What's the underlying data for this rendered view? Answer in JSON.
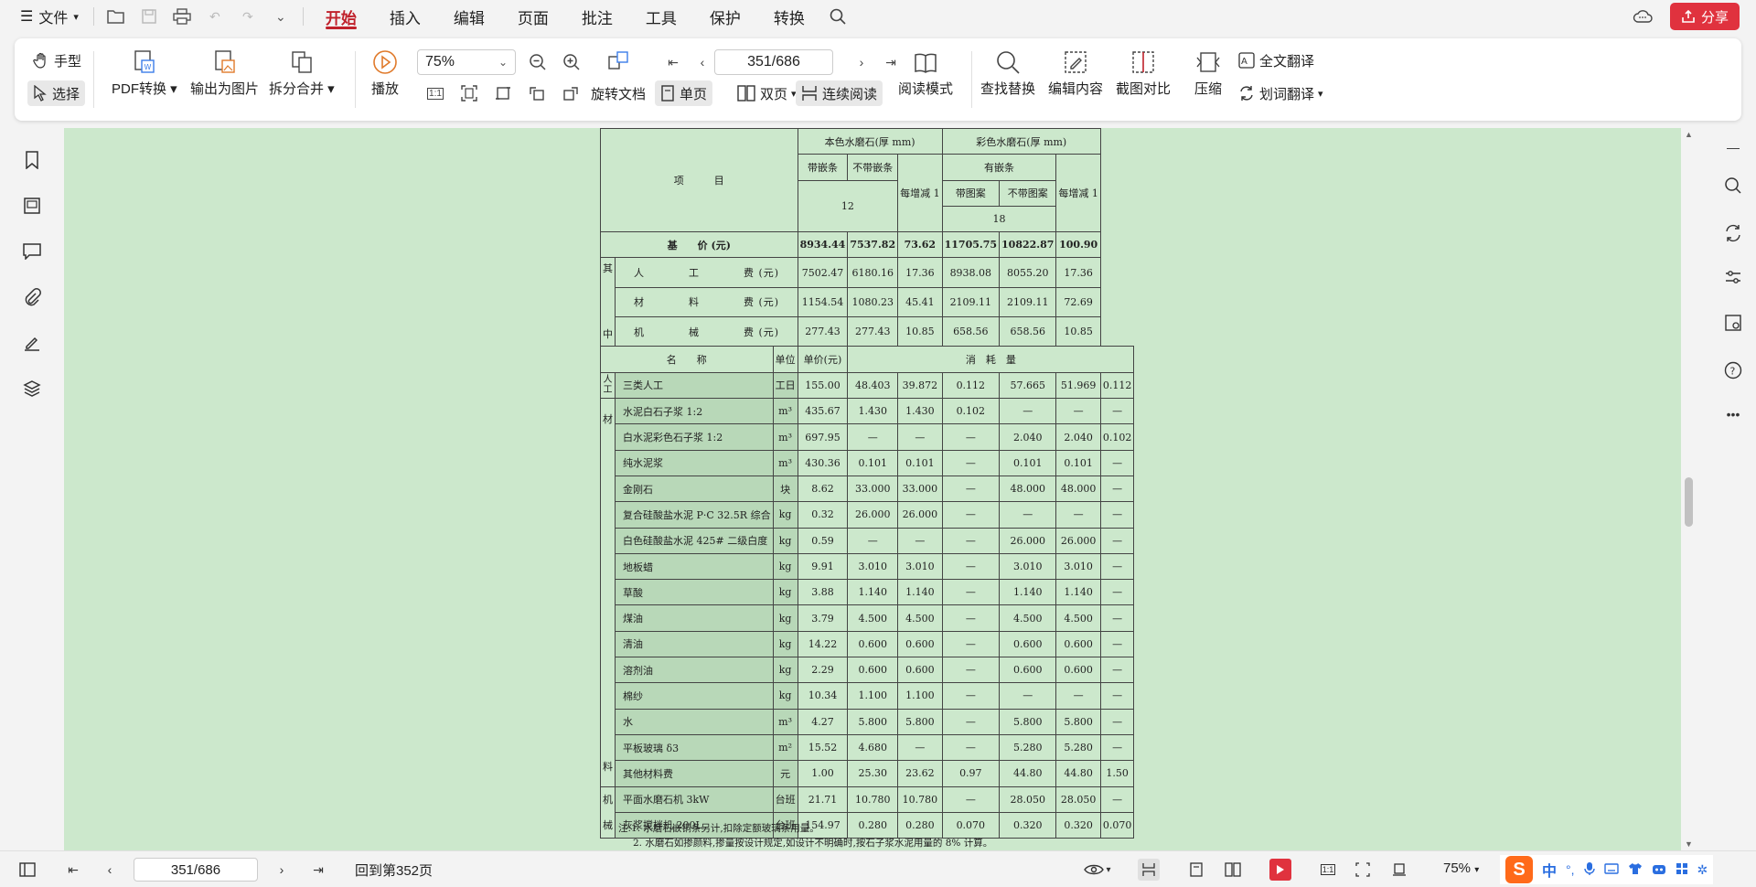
{
  "menubar": {
    "file_label": "文件",
    "tabs": [
      {
        "label": "开始",
        "active": true
      },
      {
        "label": "插入",
        "active": false
      },
      {
        "label": "编辑",
        "active": false
      },
      {
        "label": "页面",
        "active": false
      },
      {
        "label": "批注",
        "active": false
      },
      {
        "label": "工具",
        "active": false
      },
      {
        "label": "保护",
        "active": false
      },
      {
        "label": "转换",
        "active": false
      }
    ],
    "share_label": "分享"
  },
  "toolbar": {
    "hand_label": "手型",
    "select_label": "选择",
    "pdf_convert_label": "PDF转换",
    "export_image_label": "输出为图片",
    "split_merge_label": "拆分合并",
    "play_label": "播放",
    "zoom_value": "75%",
    "page_value": "351/686",
    "rotate_label": "旋转文档",
    "single_page_label": "单页",
    "double_page_label": "双页",
    "continuous_label": "连续阅读",
    "read_mode_label": "阅读模式",
    "find_replace_label": "查找替换",
    "edit_content_label": "编辑内容",
    "screenshot_compare_label": "截图对比",
    "compress_label": "压缩",
    "full_translate_label": "全文翻译",
    "word_translate_label": "划词翻译",
    "accent_color": "#c0212b"
  },
  "document": {
    "header": {
      "item_label": "项　　　目",
      "group1": "本色水磨石(厚 mm)",
      "group2": "彩色水磨石(厚 mm)",
      "g1_col1": "带嵌条",
      "g1_col2": "不带嵌条",
      "g1_thickness": "12",
      "col_each1": "每增减 1",
      "g2_sub": "有嵌条",
      "g2_col1": "带图案",
      "g2_col2": "不带图案",
      "g2_thickness": "18",
      "col_each2": "每增减 1"
    },
    "base_price": {
      "label": "基　　价 (元)",
      "values": [
        "8934.44",
        "7537.82",
        "73.62",
        "11705.75",
        "10822.87",
        "100.90"
      ]
    },
    "among_label": [
      "其",
      "中"
    ],
    "breakdown": [
      {
        "label": "人　　　　工　　　　费 (元)",
        "values": [
          "7502.47",
          "6180.16",
          "17.36",
          "8938.08",
          "8055.20",
          "17.36"
        ]
      },
      {
        "label": "材　　　　料　　　　费 (元)",
        "values": [
          "1154.54",
          "1080.23",
          "45.41",
          "2109.11",
          "2109.11",
          "72.69"
        ]
      },
      {
        "label": "机　　　　械　　　　费 (元)",
        "values": [
          "277.43",
          "277.43",
          "10.85",
          "658.56",
          "658.56",
          "10.85"
        ]
      }
    ],
    "consumption_header": {
      "name": "名　　称",
      "unit": "单位",
      "price": "单价(元)",
      "qty": "消　耗　量"
    },
    "labor_group": "人工",
    "labor_rows": [
      {
        "name": "三类人工",
        "unit": "工日",
        "price": "155.00",
        "values": [
          "48.403",
          "39.872",
          "0.112",
          "57.665",
          "51.969",
          "0.112"
        ]
      }
    ],
    "material_group": [
      "材",
      "料"
    ],
    "material_rows": [
      {
        "name": "水泥白石子浆 1:2",
        "unit": "m³",
        "price": "435.67",
        "values": [
          "1.430",
          "1.430",
          "0.102",
          "—",
          "—",
          "—"
        ]
      },
      {
        "name": "白水泥彩色石子浆 1:2",
        "unit": "m³",
        "price": "697.95",
        "values": [
          "—",
          "—",
          "—",
          "2.040",
          "2.040",
          "0.102"
        ]
      },
      {
        "name": "纯水泥浆",
        "unit": "m³",
        "price": "430.36",
        "values": [
          "0.101",
          "0.101",
          "—",
          "0.101",
          "0.101",
          "—"
        ]
      },
      {
        "name": "金刚石",
        "unit": "块",
        "price": "8.62",
        "values": [
          "33.000",
          "33.000",
          "—",
          "48.000",
          "48.000",
          "—"
        ]
      },
      {
        "name": "复合硅酸盐水泥 P·C 32.5R 综合",
        "unit": "kg",
        "price": "0.32",
        "values": [
          "26.000",
          "26.000",
          "—",
          "—",
          "—",
          "—"
        ]
      },
      {
        "name": "白色硅酸盐水泥 425# 二级白度",
        "unit": "kg",
        "price": "0.59",
        "values": [
          "—",
          "—",
          "—",
          "26.000",
          "26.000",
          "—"
        ]
      },
      {
        "name": "地板蜡",
        "unit": "kg",
        "price": "9.91",
        "values": [
          "3.010",
          "3.010",
          "—",
          "3.010",
          "3.010",
          "—"
        ]
      },
      {
        "name": "草酸",
        "unit": "kg",
        "price": "3.88",
        "values": [
          "1.140",
          "1.140",
          "—",
          "1.140",
          "1.140",
          "—"
        ]
      },
      {
        "name": "煤油",
        "unit": "kg",
        "price": "3.79",
        "values": [
          "4.500",
          "4.500",
          "—",
          "4.500",
          "4.500",
          "—"
        ]
      },
      {
        "name": "清油",
        "unit": "kg",
        "price": "14.22",
        "values": [
          "0.600",
          "0.600",
          "—",
          "0.600",
          "0.600",
          "—"
        ]
      },
      {
        "name": "溶剂油",
        "unit": "kg",
        "price": "2.29",
        "values": [
          "0.600",
          "0.600",
          "—",
          "0.600",
          "0.600",
          "—"
        ]
      },
      {
        "name": "棉纱",
        "unit": "kg",
        "price": "10.34",
        "values": [
          "1.100",
          "1.100",
          "—",
          "—",
          "—",
          "—"
        ]
      },
      {
        "name": "水",
        "unit": "m³",
        "price": "4.27",
        "values": [
          "5.800",
          "5.800",
          "—",
          "5.800",
          "5.800",
          "—"
        ]
      },
      {
        "name": "平板玻璃 δ3",
        "unit": "m²",
        "price": "15.52",
        "values": [
          "4.680",
          "—",
          "—",
          "5.280",
          "5.280",
          "—"
        ]
      },
      {
        "name": "其他材料费",
        "unit": "元",
        "price": "1.00",
        "values": [
          "25.30",
          "23.62",
          "0.97",
          "44.80",
          "44.80",
          "1.50"
        ]
      }
    ],
    "machine_group": [
      "机",
      "械"
    ],
    "machine_rows": [
      {
        "name": "平面水磨石机 3kW",
        "unit": "台班",
        "price": "21.71",
        "values": [
          "10.780",
          "10.780",
          "—",
          "28.050",
          "28.050",
          "—"
        ]
      },
      {
        "name": "灰浆搅拌机 200L",
        "unit": "台班",
        "price": "154.97",
        "values": [
          "0.280",
          "0.280",
          "0.070",
          "0.320",
          "0.320",
          "0.070"
        ]
      }
    ],
    "notes": [
      "注:1. 水磨石嵌铜条另计,扣除定额玻璃条用量。",
      "2. 水磨石如掺颜料,掺量按设计规定,如设计不明确时,按石子浆水泥用量的 8% 计算。"
    ],
    "background_color": "#cce8cc"
  },
  "statusbar": {
    "page_value": "351/686",
    "back_to_label": "回到第352页",
    "zoom_value": "75%",
    "ime_label": "中"
  }
}
